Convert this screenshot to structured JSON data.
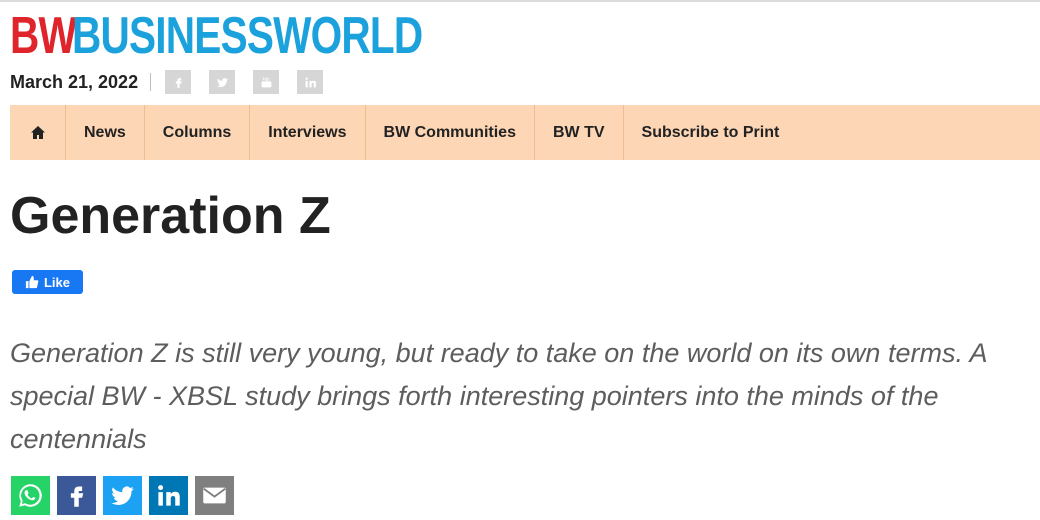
{
  "header": {
    "logo_prefix": "BW",
    "logo_name": "BUSINESSWORLD",
    "date": "March 21, 2022",
    "social_icons": [
      "facebook-icon",
      "twitter-icon",
      "youtube-icon",
      "linkedin-icon"
    ]
  },
  "nav": {
    "home_icon": "home-icon",
    "items": [
      "News",
      "Columns",
      "Interviews",
      "BW Communities",
      "BW TV",
      "Subscribe to Print"
    ]
  },
  "article": {
    "title": "Generation Z",
    "like_label": "Like",
    "summary": "Generation Z is still very young, but ready to take on the world on its own terms. A special BW - XBSL study brings forth interesting pointers into the minds of the centennials"
  },
  "share": {
    "icons": [
      "whatsapp-icon",
      "facebook-icon",
      "twitter-icon",
      "linkedin-icon",
      "email-icon"
    ]
  },
  "colors": {
    "logo_red": "#e0242b",
    "logo_blue": "#1ba1dc",
    "nav_bg": "#fcd6b5",
    "whatsapp": "#25d366",
    "facebook": "#3b5998",
    "twitter": "#1da1f2",
    "linkedin": "#0077b5",
    "email": "#7f7f7f",
    "fb_like": "#1877f2"
  }
}
